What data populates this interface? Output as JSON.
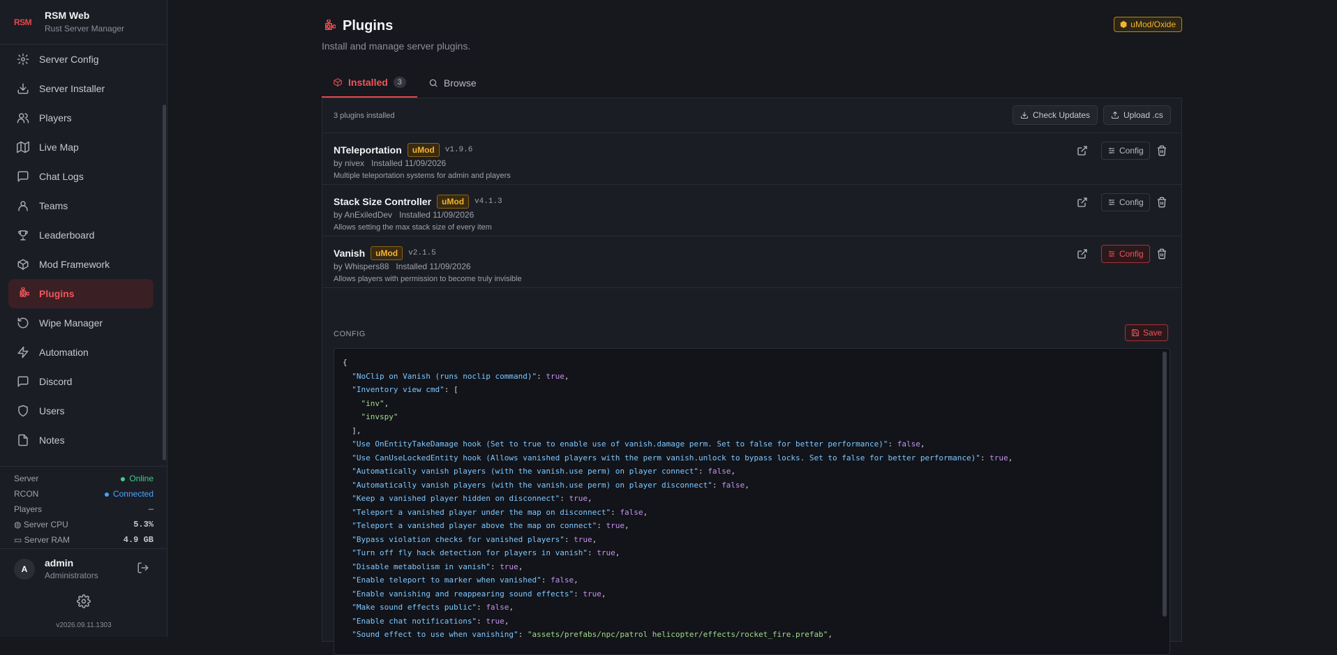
{
  "brand": {
    "logo": "RSM",
    "title": "RSM Web",
    "subtitle": "Rust Server Manager"
  },
  "sidebar": {
    "items": [
      {
        "label": "Server Config",
        "icon": "gear-icon"
      },
      {
        "label": "Server Installer",
        "icon": "download-icon"
      },
      {
        "label": "Players",
        "icon": "users-icon"
      },
      {
        "label": "Live Map",
        "icon": "map-icon"
      },
      {
        "label": "Chat Logs",
        "icon": "chat-icon"
      },
      {
        "label": "Teams",
        "icon": "team-icon"
      },
      {
        "label": "Leaderboard",
        "icon": "trophy-icon"
      },
      {
        "label": "Mod Framework",
        "icon": "box-icon"
      },
      {
        "label": "Plugins",
        "icon": "puzzle-icon",
        "active": true
      },
      {
        "label": "Wipe Manager",
        "icon": "refresh-icon"
      },
      {
        "label": "Automation",
        "icon": "bolt-icon"
      },
      {
        "label": "Discord",
        "icon": "discord-icon"
      },
      {
        "label": "Users",
        "icon": "shield-icon"
      },
      {
        "label": "Notes",
        "icon": "note-icon"
      }
    ]
  },
  "status": {
    "server_label": "Server",
    "server_value": "Online",
    "rcon_label": "RCON",
    "rcon_value": "Connected",
    "players_label": "Players",
    "players_value": "—",
    "cpu_label": "Server CPU",
    "cpu_value": "5.3%",
    "ram_label": "Server RAM",
    "ram_value": "4.9 GB",
    "online_color": "#3fcf8e",
    "connected_color": "#4aa3ff"
  },
  "user": {
    "initial": "A",
    "name": "admin",
    "role": "Administrators"
  },
  "version": "v2026.09.11.1303",
  "page": {
    "title": "Plugins",
    "subtitle": "Install and manage server plugins.",
    "framework_badge": "uMod/Oxide",
    "accent": "#e5484d"
  },
  "tabs": [
    {
      "label": "Installed",
      "count": "3"
    },
    {
      "label": "Browse"
    }
  ],
  "list": {
    "summary": "3 plugins installed",
    "check_updates": "Check Updates",
    "upload": "Upload .cs"
  },
  "plugins": [
    {
      "name": "NTeleportation",
      "badge": "uMod",
      "version": "v1.9.6",
      "author": "by nivex",
      "installed": "Installed 11/09/2026",
      "description": "Multiple teleportation systems for admin and players",
      "config_label": "Config"
    },
    {
      "name": "Stack Size Controller",
      "badge": "uMod",
      "version": "v4.1.3",
      "author": "by AnExiledDev",
      "installed": "Installed 11/09/2026",
      "description": "Allows setting the max stack size of every item",
      "config_label": "Config"
    },
    {
      "name": "Vanish",
      "badge": "uMod",
      "version": "v2.1.5",
      "author": "by Whispers88",
      "installed": "Installed 11/09/2026",
      "description": "Allows players with permission to become truly invisible",
      "config_label": "Config"
    }
  ],
  "config": {
    "label": "CONFIG",
    "save": "Save",
    "lines": [
      "{",
      "  \"NoClip on Vanish (runs noclip command)\": true,",
      "  \"Inventory view cmd\": [",
      "    \"inv\",",
      "    \"invspy\"",
      "  ],",
      "  \"Use OnEntityTakeDamage hook (Set to true to enable use of vanish.damage perm. Set to false for better performance)\": false,",
      "  \"Use CanUseLockedEntity hook (Allows vanished players with the perm vanish.unlock to bypass locks. Set to false for better performance)\": true,",
      "  \"Automatically vanish players (with the vanish.use perm) on player connect\": false,",
      "  \"Automatically vanish players (with the vanish.use perm) on player disconnect\": false,",
      "  \"Keep a vanished player hidden on disconnect\": true,",
      "  \"Teleport a vanished player under the map on disconnect\": false,",
      "  \"Teleport a vanished player above the map on connect\": true,",
      "  \"Bypass violation checks for vanished players\": true,",
      "  \"Turn off fly hack detection for players in vanish\": true,",
      "  \"Disable metabolism in vanish\": true,",
      "  \"Enable teleport to marker when vanished\": false,",
      "  \"Enable vanishing and reappearing sound effects\": true,",
      "  \"Make sound effects public\": false,",
      "  \"Enable chat notifications\": true,",
      "  \"Sound effect to use when vanishing\": \"assets/prefabs/npc/patrol helicopter/effects/rocket_fire.prefab\","
    ]
  }
}
